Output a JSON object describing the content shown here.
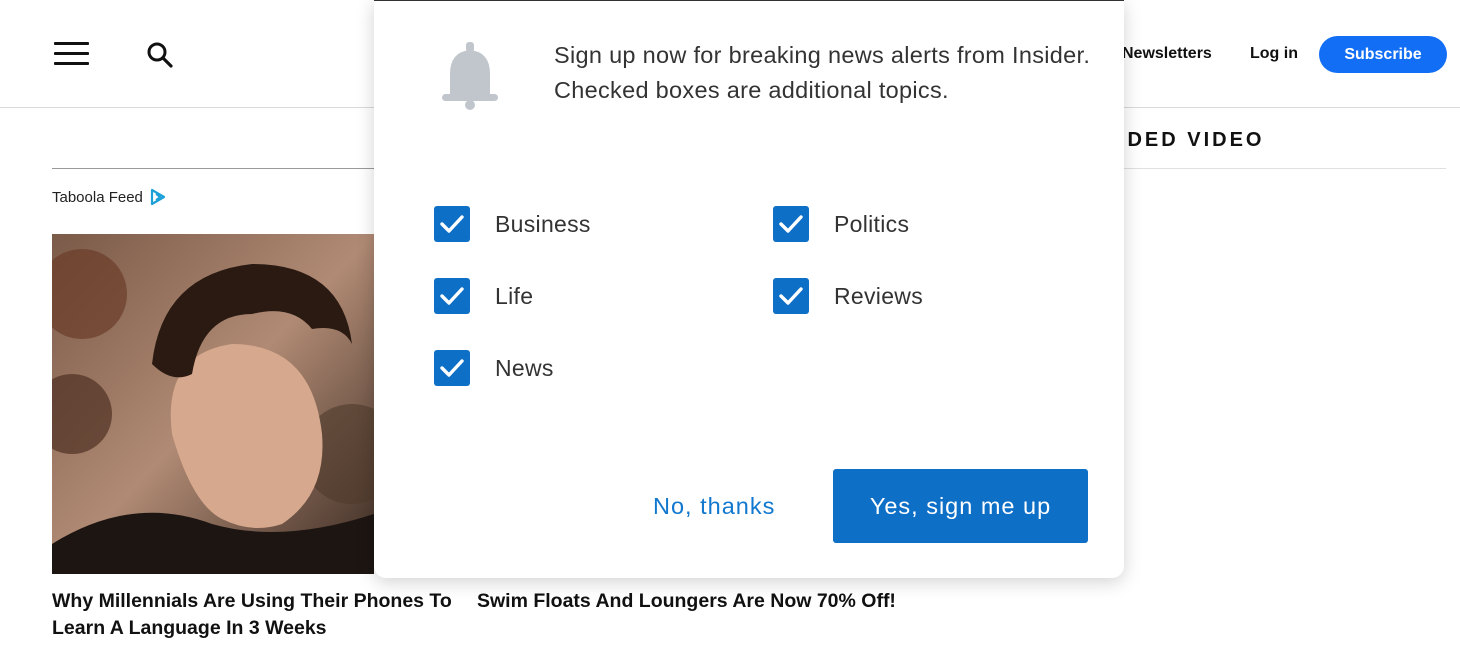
{
  "header": {
    "newsletters_label": "Newsletters",
    "login_label": "Log in",
    "subscribe_label": "Subscribe"
  },
  "sidebar": {
    "section_title": "NDED VIDEO"
  },
  "feed": {
    "label": "Taboola Feed",
    "articles": [
      {
        "title": "Why Millennials Are Using Their Phones To Learn A Language In 3 Weeks"
      },
      {
        "title": "Swim Floats And Loungers Are Now 70% Off!"
      }
    ]
  },
  "modal": {
    "prompt_line1": "Sign up now for breaking news alerts from Insider.",
    "prompt_line2": "Checked boxes are additional topics.",
    "topics": [
      {
        "label": "Business",
        "checked": true
      },
      {
        "label": "Politics",
        "checked": true
      },
      {
        "label": "Life",
        "checked": true
      },
      {
        "label": "Reviews",
        "checked": true
      },
      {
        "label": "News",
        "checked": true
      }
    ],
    "decline_label": "No, thanks",
    "accept_label": "Yes, sign me up"
  },
  "colors": {
    "accent": "#0e6fc7",
    "subscribe": "#136ef6",
    "bell": "#c1c6cd"
  }
}
